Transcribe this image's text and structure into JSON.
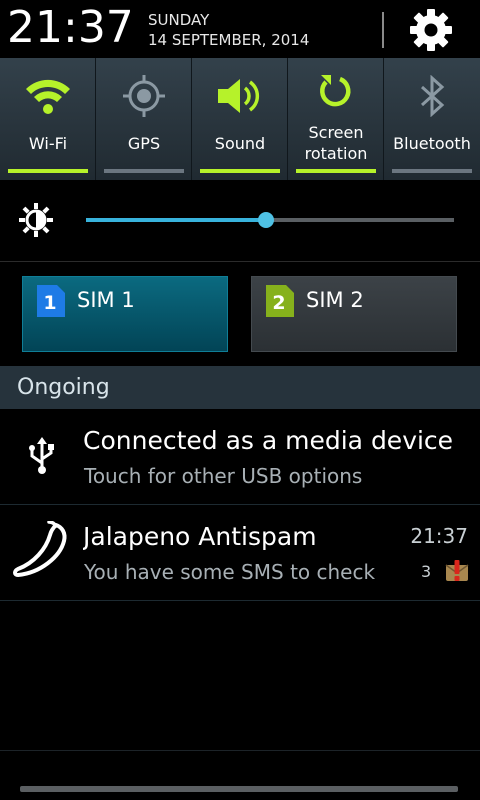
{
  "header": {
    "time": "21:37",
    "day": "SUNDAY",
    "date": "14 SEPTEMBER, 2014",
    "settings_icon": "gear-icon"
  },
  "toggles": [
    {
      "label": "Wi-Fi",
      "icon": "wifi-icon",
      "on": true
    },
    {
      "label": "GPS",
      "icon": "gps-icon",
      "on": false
    },
    {
      "label": "Sound",
      "icon": "speaker-icon",
      "on": true
    },
    {
      "label": "Screen rotation",
      "line1": "Screen",
      "line2": "rotation",
      "icon": "rotate-icon",
      "on": true
    },
    {
      "label": "Bluetooth",
      "icon": "bluetooth-icon",
      "on": false
    }
  ],
  "brightness": {
    "icon": "brightness-icon",
    "level": 0.49
  },
  "sims": [
    {
      "number": "1",
      "label": "SIM 1",
      "active": true,
      "badge_color": "#1e7be6"
    },
    {
      "number": "2",
      "label": "SIM 2",
      "active": false,
      "badge_color": "#86b11c"
    }
  ],
  "ongoing": {
    "header": "Ongoing"
  },
  "notifications": [
    {
      "icon": "usb-icon",
      "title": "Connected as a media device",
      "subtitle": "Touch for other USB options"
    },
    {
      "icon": "jalapeno-icon",
      "title": "Jalapeno Antispam",
      "subtitle": "You have some SMS to check",
      "time": "21:37",
      "count": "3",
      "badge_icon": "alert-badge-icon"
    }
  ],
  "colors": {
    "accent_on": "#b6f22a",
    "slider": "#38b3dc",
    "section_bg": "#26333c"
  }
}
